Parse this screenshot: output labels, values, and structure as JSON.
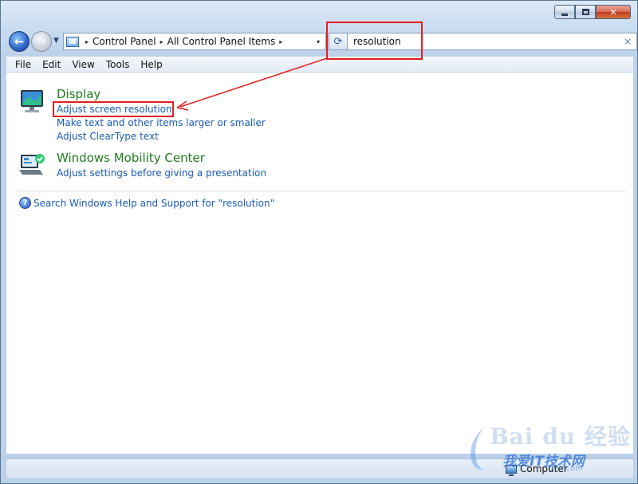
{
  "window": {
    "caption_minimize_label": "–",
    "caption_close_label": "✕"
  },
  "address": {
    "crumbs": [
      "Control Panel",
      "All Control Panel Items"
    ],
    "separator_glyph": "▸",
    "dropdown_glyph": "▾"
  },
  "search": {
    "value": "resolution",
    "clear_glyph": "×"
  },
  "menu": {
    "items": [
      "File",
      "Edit",
      "View",
      "Tools",
      "Help"
    ]
  },
  "results": [
    {
      "title": "Display",
      "icon": "display-icon",
      "tasks": [
        "Adjust screen resolution",
        "Make text and other items larger or smaller",
        "Adjust ClearType text"
      ]
    },
    {
      "title": "Windows Mobility Center",
      "icon": "mobility-center-icon",
      "tasks": [
        "Adjust settings before giving a presentation"
      ]
    }
  ],
  "help": {
    "text": "Search Windows Help and Support for \"resolution\""
  },
  "status": {
    "computer_label": "Computer"
  },
  "watermark": {
    "logo": "Bai du 经验",
    "text": "我爱IT技术网",
    "url": "52ij.com"
  },
  "colors": {
    "annotation_red": "#e02020",
    "link_blue": "#1a5bb5",
    "title_green": "#1e7b1e"
  }
}
